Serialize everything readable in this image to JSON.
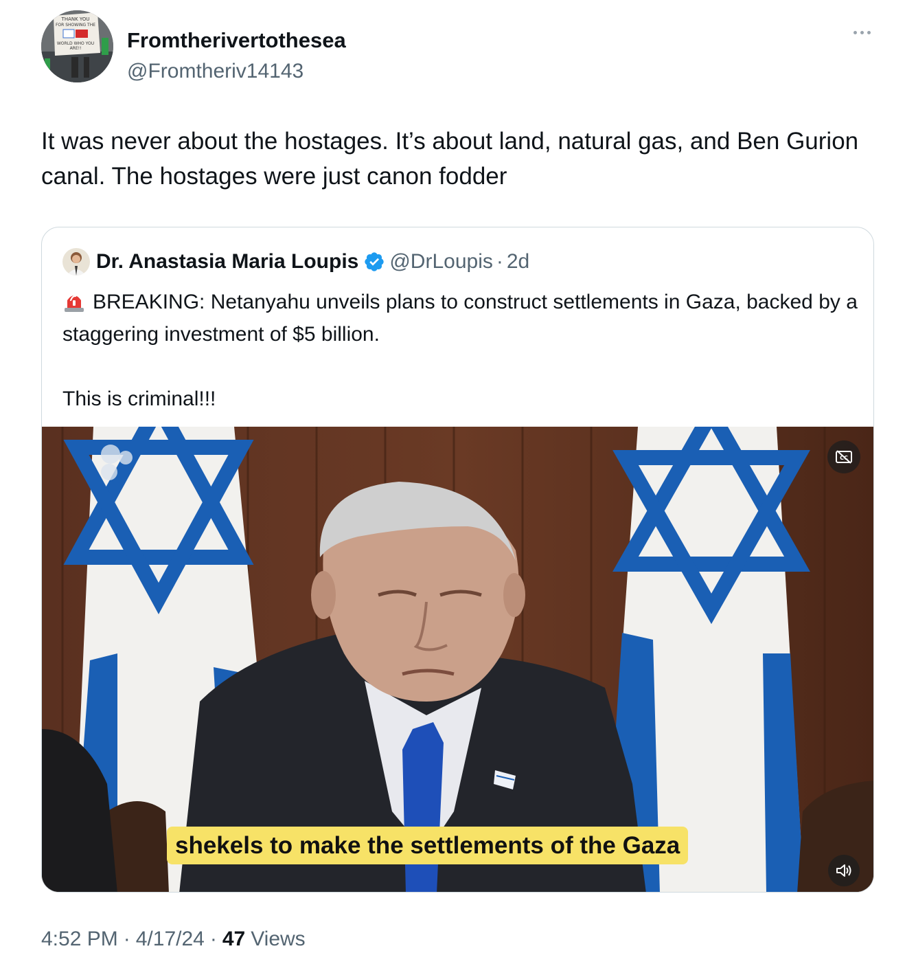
{
  "author": {
    "display_name": "Fromtherivertothesea",
    "handle": "@Fromtheriv14143",
    "avatar_sign_text": "THANK YOU FOR SHOWING THE WORLD WHO YOU ARE!!"
  },
  "tweet": {
    "text": "It was never about the hostages. It’s about land, natural gas, and Ben Gurion canal. The hostages were just canon fodder"
  },
  "quoted": {
    "display_name": "Dr. Anastasia Maria Loupis",
    "handle": "@DrLoupis",
    "separator": "·",
    "age": "2d",
    "text_line1": "BREAKING: Netanyahu unveils plans to construct settlements in Gaza, backed by a staggering investment of $5 billion.",
    "text_line2": "This is criminal!!!",
    "media": {
      "caption": "shekels to make the settlements of the Gaza",
      "cc_icon": "captions-off-icon",
      "volume_icon": "muted-volume-icon"
    }
  },
  "meta": {
    "time": "4:52 PM",
    "sep1": "·",
    "date": "4/17/24",
    "sep2": "·",
    "views_count": "47",
    "views_label": "Views"
  },
  "colors": {
    "text_primary": "#0f1419",
    "text_secondary": "#536471",
    "border": "#cfd9de",
    "verified": "#1d9bf0",
    "flag_blue": "#1a5fb4",
    "caption_bg": "#f7e267"
  }
}
